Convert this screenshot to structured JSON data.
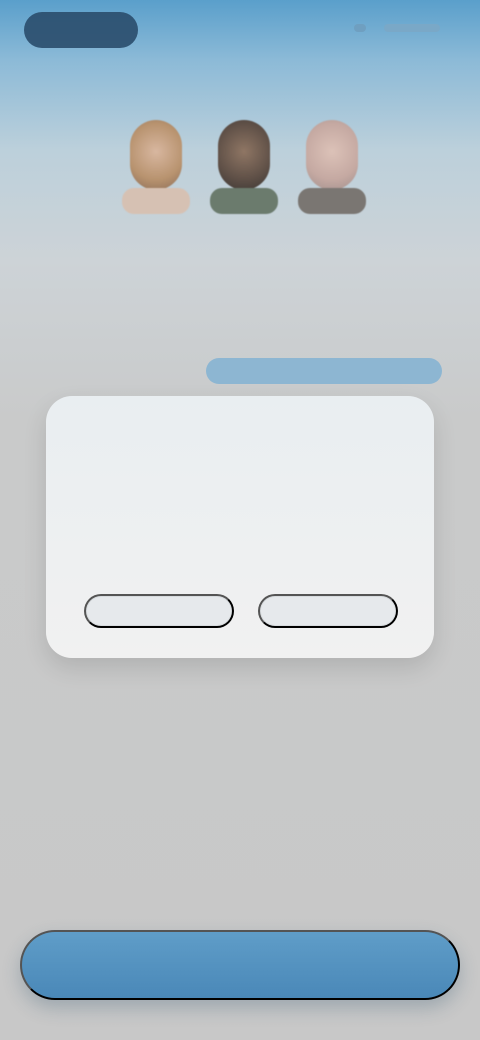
{
  "header": {
    "left_badge": "",
    "right_status": ""
  },
  "hero": {
    "title_line1": "",
    "title_line2": "",
    "tag_label": ""
  },
  "dialog": {
    "title": "",
    "body": "",
    "primary_button": "",
    "secondary_button": ""
  },
  "footer": {
    "note": "",
    "cta_label": ""
  },
  "colors": {
    "accent": "#4a88b8",
    "background": "#c8c8c8",
    "card": "#efefef"
  }
}
